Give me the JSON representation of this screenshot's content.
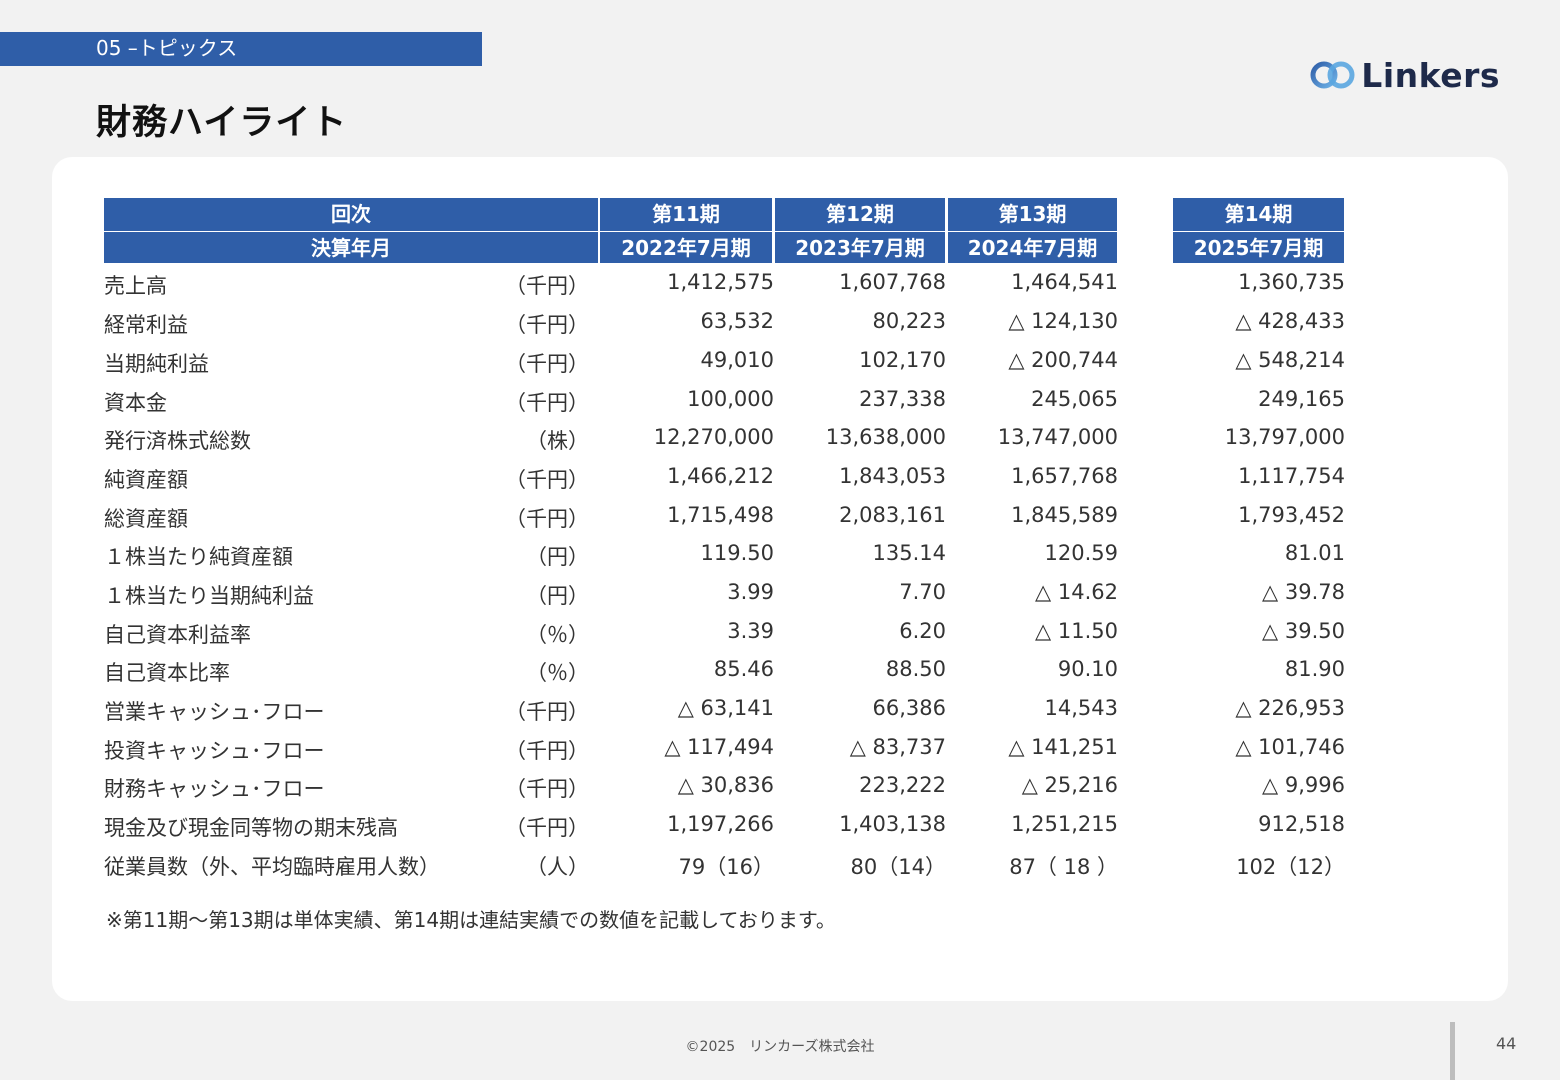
{
  "section": "05 –トピックス",
  "title": "財務ハイライト",
  "logo_text": "Linkers",
  "header": {
    "label_line1": "回次",
    "label_line2": "決算年月",
    "periods": [
      {
        "line1": "第11期",
        "line2": "2022年7月期"
      },
      {
        "line1": "第12期",
        "line2": "2023年7月期"
      },
      {
        "line1": "第13期",
        "line2": "2024年7月期"
      },
      {
        "line1": "第14期",
        "line2": "2025年7月期"
      }
    ]
  },
  "rows": [
    {
      "label": "売上高",
      "unit": "（千円）",
      "values": [
        "1,412,575",
        "1,607,768",
        "1,464,541",
        "1,360,735"
      ]
    },
    {
      "label": "経常利益",
      "unit": "（千円）",
      "values": [
        "63,532",
        "80,223",
        "△ 124,130",
        "△ 428,433"
      ]
    },
    {
      "label": "当期純利益",
      "unit": "（千円）",
      "values": [
        "49,010",
        "102,170",
        "△ 200,744",
        "△ 548,214"
      ]
    },
    {
      "label": "資本金",
      "unit": "（千円）",
      "values": [
        "100,000",
        "237,338",
        "245,065",
        "249,165"
      ]
    },
    {
      "label": "発行済株式総数",
      "unit": "（株）",
      "values": [
        "12,270,000",
        "13,638,000",
        "13,747,000",
        "13,797,000"
      ]
    },
    {
      "label": "純資産額",
      "unit": "（千円）",
      "values": [
        "1,466,212",
        "1,843,053",
        "1,657,768",
        "1,117,754"
      ]
    },
    {
      "label": "総資産額",
      "unit": "（千円）",
      "values": [
        "1,715,498",
        "2,083,161",
        "1,845,589",
        "1,793,452"
      ]
    },
    {
      "label": "１株当たり純資産額",
      "unit": "（円）",
      "values": [
        "119.50",
        "135.14",
        "120.59",
        "81.01"
      ]
    },
    {
      "label": "１株当たり当期純利益",
      "unit": "（円）",
      "values": [
        "3.99",
        "7.70",
        "△ 14.62",
        "△ 39.78"
      ]
    },
    {
      "label": "自己資本利益率",
      "unit": "（％）",
      "values": [
        "3.39",
        "6.20",
        "△ 11.50",
        "△ 39.50"
      ]
    },
    {
      "label": "自己資本比率",
      "unit": "（％）",
      "values": [
        "85.46",
        "88.50",
        "90.10",
        "81.90"
      ]
    },
    {
      "label": "営業キャッシュ･フロー",
      "unit": "（千円）",
      "values": [
        "△ 63,141",
        "66,386",
        "14,543",
        "△ 226,953"
      ]
    },
    {
      "label": "投資キャッシュ･フロー",
      "unit": "（千円）",
      "values": [
        "△ 117,494",
        "△ 83,737",
        "△ 141,251",
        "△ 101,746"
      ]
    },
    {
      "label": "財務キャッシュ･フロー",
      "unit": "（千円）",
      "values": [
        "△ 30,836",
        "223,222",
        "△ 25,216",
        "△ 9,996"
      ]
    },
    {
      "label": "現金及び現金同等物の期末残高",
      "unit": "（千円）",
      "values": [
        "1,197,266",
        "1,403,138",
        "1,251,215",
        "912,518"
      ]
    },
    {
      "label": "従業員数（外、平均臨時雇用人数）",
      "unit": "（人）",
      "values": [
        "79（16）",
        "80（14）",
        "87（ 18 ）",
        "102（12）"
      ]
    }
  ],
  "note": "※第11期～第13期は単体実績、第14期は連結実績での数値を記載しております。",
  "footer": "©2025　リンカーズ株式会社",
  "page_number": "44",
  "colors": {
    "accent": "#2f5ea8",
    "background": "#f2f2f2",
    "card": "#ffffff"
  }
}
